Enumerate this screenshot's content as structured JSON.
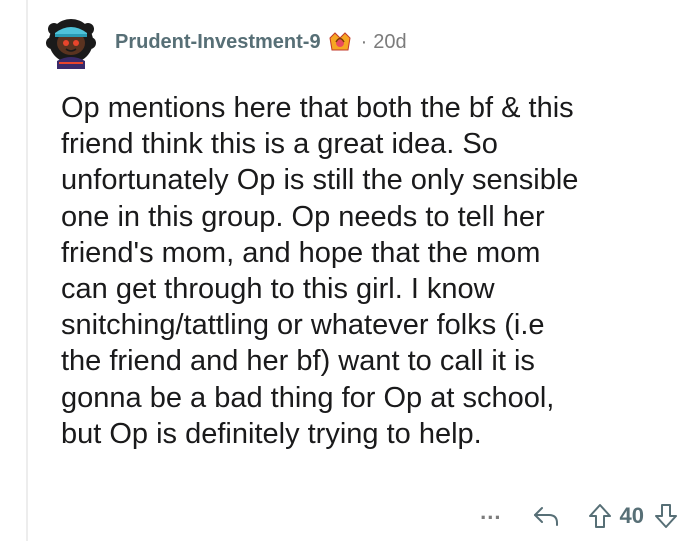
{
  "comment": {
    "username": "Prudent-Investment-9",
    "separator": "·",
    "age": "20d",
    "body_lines": [
      "Op mentions here that both the bf & this",
      "friend think this is a great idea. So",
      "unfortunately Op is still the only sensible",
      "one in this group. Op needs to tell her",
      "friend's mom, and hope that the mom",
      "can get through to this girl. I know",
      "snitching/tattling or whatever folks (i.e",
      "the friend and her bf) want to call it is",
      "gonna be a bad thing for Op at school,",
      "but Op is definitely trying to help."
    ]
  },
  "actions": {
    "more_label": "...",
    "vote_count": "40"
  },
  "icons": {
    "avatar": "snoo-avatar-icon",
    "flair": "award-badge-icon",
    "reply": "reply-arrow-icon",
    "upvote": "upvote-arrow-icon",
    "downvote": "downvote-arrow-icon"
  },
  "colors": {
    "username": "#576f76",
    "meta": "#7c7c7c",
    "body": "#1a1a1b",
    "avatar_skin": "#5a3320",
    "avatar_cap": "#4fc3d9"
  }
}
